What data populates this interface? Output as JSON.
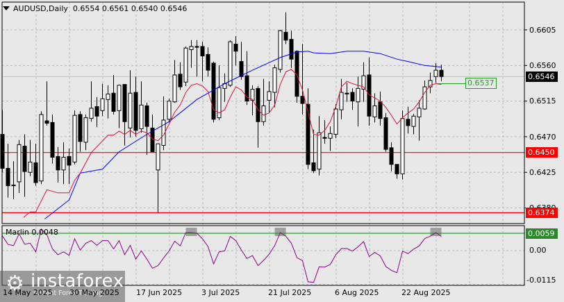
{
  "header": {
    "symbol_timeframe": "AUDUSD,Daily",
    "open": "0.6554",
    "high": "0.6561",
    "low": "0.6540",
    "close": "0.6546"
  },
  "indicator": {
    "label": "Marlin 0.0048"
  },
  "price_axis": [
    "0.6605",
    "0.6560",
    "0.6515",
    "0.6470",
    "0.6425",
    "0.6380"
  ],
  "indicator_axis": [
    "0.00",
    "-0.0115"
  ],
  "tags": {
    "current": "0.6546",
    "level_upper": "0.6450",
    "level_lower": "0.6374",
    "indicator_level": "0.0059",
    "ma_value": "0.6537"
  },
  "date_axis": [
    "14 May 2025",
    "30 May 2025",
    "17 Jun 2025",
    "3 Jul 2025",
    "21 Jul 2025",
    "6 Aug 2025",
    "22 Aug 2025"
  ],
  "logo": {
    "name": "instaforex",
    "tagline": "Instant Forex Trading"
  },
  "colors": {
    "bg": "#e8e8e8",
    "red_level": "#ff0000",
    "green_level": "#2a9a2a",
    "fast_ma": "#e0103c",
    "slow_ma": "#0000ff",
    "oscillator": "#8b008b",
    "current_tag": "#000000"
  },
  "chart_data": {
    "type": "candlestick",
    "levels": {
      "price": [
        0.645,
        0.6374
      ],
      "current": 0.6546,
      "ma": 0.6537,
      "indicator": 0.0059
    },
    "price_range": [
      0.636,
      0.664
    ],
    "indicator_range": [
      -0.0118,
      0.0085
    ],
    "ohlc": [
      [
        0.6473,
        0.6504,
        0.6425,
        0.643
      ],
      [
        0.643,
        0.6461,
        0.6393,
        0.6408
      ],
      [
        0.6408,
        0.6439,
        0.6391,
        0.6409
      ],
      [
        0.6413,
        0.6466,
        0.6399,
        0.646
      ],
      [
        0.6458,
        0.6473,
        0.6394,
        0.6426
      ],
      [
        0.6425,
        0.6466,
        0.642,
        0.6438
      ],
      [
        0.6437,
        0.6461,
        0.6408,
        0.6412
      ],
      [
        0.6414,
        0.6502,
        0.641,
        0.6498
      ],
      [
        0.649,
        0.654,
        0.6484,
        0.6487
      ],
      [
        0.6488,
        0.6498,
        0.6436,
        0.6444
      ],
      [
        0.6445,
        0.6457,
        0.6412,
        0.6428
      ],
      [
        0.6428,
        0.6463,
        0.641,
        0.6444
      ],
      [
        0.6445,
        0.6455,
        0.641,
        0.6434
      ],
      [
        0.6438,
        0.6503,
        0.6435,
        0.6497
      ],
      [
        0.6498,
        0.6502,
        0.6451,
        0.6464
      ],
      [
        0.6463,
        0.6498,
        0.6453,
        0.6494
      ],
      [
        0.6493,
        0.654,
        0.6489,
        0.6506
      ],
      [
        0.6508,
        0.652,
        0.6482,
        0.6496
      ],
      [
        0.6503,
        0.6537,
        0.6496,
        0.6518
      ],
      [
        0.6517,
        0.6535,
        0.6493,
        0.6524
      ],
      [
        0.6525,
        0.6548,
        0.6498,
        0.6502
      ],
      [
        0.6503,
        0.6536,
        0.6481,
        0.6535
      ],
      [
        0.6536,
        0.6536,
        0.6459,
        0.6489
      ],
      [
        0.6481,
        0.6554,
        0.6469,
        0.6525
      ],
      [
        0.6526,
        0.6546,
        0.647,
        0.6478
      ],
      [
        0.648,
        0.654,
        0.6475,
        0.651
      ],
      [
        0.6509,
        0.6513,
        0.6447,
        0.6483
      ],
      [
        0.6481,
        0.6498,
        0.6451,
        0.6451
      ],
      [
        0.6428,
        0.6461,
        0.6374,
        0.6461
      ],
      [
        0.6459,
        0.6521,
        0.6453,
        0.6491
      ],
      [
        0.6492,
        0.6518,
        0.6488,
        0.6515
      ],
      [
        0.6514,
        0.6567,
        0.6513,
        0.6548
      ],
      [
        0.6549,
        0.6564,
        0.6529,
        0.6533
      ],
      [
        0.6539,
        0.6584,
        0.6534,
        0.6582
      ],
      [
        0.658,
        0.6592,
        0.6557,
        0.6584
      ],
      [
        0.6584,
        0.6592,
        0.6546,
        0.6583
      ],
      [
        0.6584,
        0.659,
        0.654,
        0.6572
      ],
      [
        0.6574,
        0.6583,
        0.6546,
        0.6554
      ],
      [
        0.6563,
        0.6565,
        0.6488,
        0.6492
      ],
      [
        0.6494,
        0.656,
        0.6491,
        0.6532
      ],
      [
        0.6531,
        0.655,
        0.6514,
        0.6537
      ],
      [
        0.6535,
        0.6592,
        0.6533,
        0.659
      ],
      [
        0.6587,
        0.6597,
        0.656,
        0.6578
      ],
      [
        0.6565,
        0.659,
        0.6542,
        0.6546
      ],
      [
        0.6547,
        0.6578,
        0.651,
        0.6515
      ],
      [
        0.6516,
        0.6535,
        0.6497,
        0.653
      ],
      [
        0.6531,
        0.6534,
        0.6456,
        0.6489
      ],
      [
        0.6489,
        0.6543,
        0.6484,
        0.6509
      ],
      [
        0.6516,
        0.654,
        0.6501,
        0.6527
      ],
      [
        0.6526,
        0.6561,
        0.6507,
        0.6557
      ],
      [
        0.6555,
        0.6605,
        0.6551,
        0.6604
      ],
      [
        0.6602,
        0.6627,
        0.6587,
        0.6592
      ],
      [
        0.6593,
        0.6604,
        0.6557,
        0.6568
      ],
      [
        0.6578,
        0.6579,
        0.6513,
        0.6521
      ],
      [
        0.6521,
        0.6587,
        0.6498,
        0.6512
      ],
      [
        0.6511,
        0.6531,
        0.6429,
        0.6435
      ],
      [
        0.6437,
        0.6479,
        0.6424,
        0.6427
      ],
      [
        0.6429,
        0.6496,
        0.6421,
        0.6475
      ],
      [
        0.6469,
        0.6491,
        0.6461,
        0.6468
      ],
      [
        0.6468,
        0.6483,
        0.6452,
        0.6474
      ],
      [
        0.6473,
        0.6511,
        0.6468,
        0.6505
      ],
      [
        0.6504,
        0.6543,
        0.6492,
        0.6526
      ],
      [
        0.6525,
        0.6538,
        0.6514,
        0.6524
      ],
      [
        0.6526,
        0.6531,
        0.6504,
        0.6515
      ],
      [
        0.6514,
        0.6546,
        0.6483,
        0.6531
      ],
      [
        0.653,
        0.6564,
        0.6514,
        0.6547
      ],
      [
        0.6548,
        0.657,
        0.6484,
        0.6496
      ],
      [
        0.6495,
        0.6525,
        0.6488,
        0.6509
      ],
      [
        0.6514,
        0.6527,
        0.6484,
        0.6493
      ],
      [
        0.6494,
        0.65,
        0.6451,
        0.6454
      ],
      [
        0.6456,
        0.6463,
        0.6426,
        0.6435
      ],
      [
        0.6435,
        0.6435,
        0.6417,
        0.6423
      ],
      [
        0.6423,
        0.6503,
        0.6416,
        0.6493
      ],
      [
        0.6492,
        0.6508,
        0.6474,
        0.6484
      ],
      [
        0.6483,
        0.6499,
        0.6473,
        0.6496
      ],
      [
        0.6495,
        0.6516,
        0.6465,
        0.6506
      ],
      [
        0.6505,
        0.6541,
        0.6504,
        0.6533
      ],
      [
        0.6533,
        0.6551,
        0.6525,
        0.6541
      ],
      [
        0.6546,
        0.6563,
        0.6538,
        0.6554
      ],
      [
        0.6554,
        0.6561,
        0.654,
        0.6546
      ]
    ],
    "fast_ma": [
      [
        3.8,
        0.6368
      ],
      [
        5,
        0.6375
      ],
      [
        6,
        0.6375
      ],
      [
        8,
        0.6403
      ],
      [
        10,
        0.6399
      ],
      [
        12,
        0.6399
      ],
      [
        13,
        0.6415
      ],
      [
        14,
        0.6424
      ],
      [
        16,
        0.645
      ],
      [
        19,
        0.6472
      ],
      [
        20,
        0.6472
      ],
      [
        21,
        0.6477
      ],
      [
        22,
        0.6473
      ],
      [
        23,
        0.6478
      ],
      [
        24,
        0.6473
      ],
      [
        25,
        0.6477
      ],
      [
        26,
        0.6475
      ],
      [
        27,
        0.6467
      ],
      [
        28,
        0.6465
      ],
      [
        29,
        0.6472
      ],
      [
        30,
        0.6486
      ],
      [
        31,
        0.6501
      ],
      [
        32,
        0.651
      ],
      [
        33,
        0.6526
      ],
      [
        34,
        0.6535
      ],
      [
        35,
        0.6537
      ],
      [
        36,
        0.6534
      ],
      [
        37,
        0.6527
      ],
      [
        38,
        0.6504
      ],
      [
        39,
        0.65
      ],
      [
        40,
        0.6504
      ],
      [
        41,
        0.652
      ],
      [
        42,
        0.6533
      ],
      [
        43,
        0.6529
      ],
      [
        44,
        0.652
      ],
      [
        45,
        0.6517
      ],
      [
        46,
        0.6504
      ],
      [
        47,
        0.6497
      ],
      [
        48,
        0.65
      ],
      [
        49,
        0.651
      ],
      [
        50,
        0.6536
      ],
      [
        51,
        0.6552
      ],
      [
        52,
        0.6555
      ],
      [
        53,
        0.6548
      ],
      [
        54,
        0.6529
      ],
      [
        55,
        0.6501
      ],
      [
        56,
        0.6473
      ],
      [
        57,
        0.6472
      ],
      [
        58,
        0.6478
      ],
      [
        59,
        0.6489
      ],
      [
        60,
        0.6508
      ],
      [
        61,
        0.6533
      ],
      [
        62,
        0.654
      ],
      [
        63,
        0.6537
      ],
      [
        64,
        0.6535
      ],
      [
        65,
        0.6533
      ],
      [
        66,
        0.6523
      ],
      [
        67,
        0.6519
      ],
      [
        68,
        0.6515
      ],
      [
        69,
        0.6507
      ],
      [
        70,
        0.6497
      ],
      [
        71,
        0.6486
      ],
      [
        72,
        0.6494
      ],
      [
        73,
        0.65
      ],
      [
        74,
        0.6505
      ],
      [
        75,
        0.6514
      ],
      [
        76,
        0.6526
      ],
      [
        77,
        0.6535
      ],
      [
        78,
        0.6537
      ],
      [
        79,
        0.6536
      ]
    ],
    "slow_ma": [
      [
        7.6,
        0.6366
      ],
      [
        12,
        0.639
      ],
      [
        14,
        0.6424
      ],
      [
        18,
        0.6429
      ],
      [
        21,
        0.6451
      ],
      [
        26,
        0.6473
      ],
      [
        30,
        0.6489
      ],
      [
        35,
        0.6517
      ],
      [
        40,
        0.6537
      ],
      [
        45,
        0.6554
      ],
      [
        50,
        0.657
      ],
      [
        53,
        0.6577
      ],
      [
        55,
        0.6578
      ],
      [
        56,
        0.6576
      ],
      [
        59,
        0.6575
      ],
      [
        62,
        0.6578
      ],
      [
        65,
        0.6578
      ],
      [
        68,
        0.6575
      ],
      [
        71,
        0.6568
      ],
      [
        73,
        0.6565
      ],
      [
        76,
        0.656
      ],
      [
        79,
        0.6558
      ]
    ],
    "marlin": [
      0.005,
      0.0021,
      0.0017,
      0.0057,
      0.0022,
      0.0025,
      -0.0004,
      0.0073,
      0.0054,
      0.0006,
      -0.0014,
      -0.0004,
      -0.0016,
      0.004,
      0.0002,
      0.0025,
      0.0034,
      0.0018,
      0.0034,
      0.0034,
      0.0006,
      0.0034,
      -0.0014,
      0.0018,
      -0.0029,
      -0.0001,
      -0.0029,
      -0.006,
      -0.0051,
      -0.0025,
      -0.0001,
      0.0032,
      0.0016,
      0.0061,
      0.0061,
      0.0059,
      0.004,
      0.0014,
      -0.0045,
      -0.0004,
      -0.0001,
      0.0048,
      0.0034,
      0.0002,
      -0.0027,
      -0.0017,
      -0.0051,
      -0.0033,
      -0.0012,
      0.0017,
      0.0061,
      0.0049,
      0.0025,
      -0.0024,
      -0.0034,
      -0.0106,
      -0.0108,
      -0.0055,
      -0.0056,
      -0.0047,
      -0.0014,
      0.0007,
      0.0007,
      -0.0002,
      0.0013,
      0.0031,
      -0.002,
      -0.0006,
      -0.0018,
      -0.0054,
      -0.0067,
      -0.0075,
      -0.0002,
      -0.001,
      0.0005,
      0.0016,
      0.0041,
      0.0049,
      0.0061,
      0.0048
    ],
    "highlight_indices": [
      34,
      50,
      78
    ]
  }
}
